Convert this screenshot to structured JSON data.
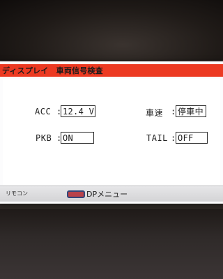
{
  "title": "ディスプレイ　車両信号検査",
  "fields": {
    "acc": {
      "label": "ACC",
      "colon": ":",
      "value": "12.4 V"
    },
    "speed": {
      "label": "車速",
      "colon": ":",
      "value": "停車中"
    },
    "pkb": {
      "label": "PKB",
      "colon": ":",
      "value": "ON"
    },
    "tail": {
      "label": "TAIL",
      "colon": ":",
      "value": "OFF"
    }
  },
  "footer": {
    "remote_label": "リモコン",
    "dp_menu_label": "DPメニュー"
  },
  "colors": {
    "title_bar": "#ec3a22",
    "dp_key_fill": "#b9424a",
    "dp_key_border": "#354779"
  }
}
